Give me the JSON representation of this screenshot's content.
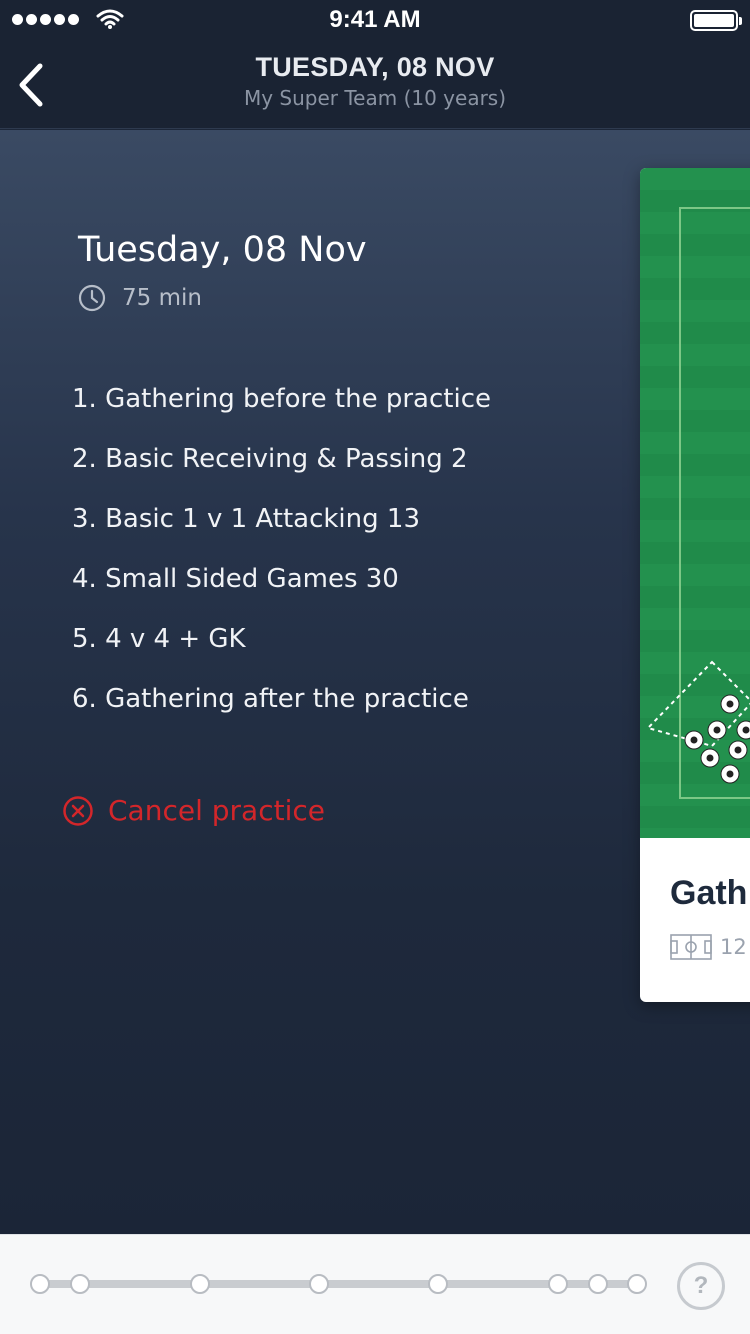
{
  "status": {
    "time": "9:41 AM"
  },
  "nav": {
    "title": "TUESDAY, 08 NOV",
    "subtitle": "My Super Team (10 years)"
  },
  "session": {
    "date": "Tuesday, 08 Nov",
    "duration": "75 min",
    "drills": [
      "1. Gathering before the practice",
      "2. Basic Receiving & Passing 2",
      "3. Basic 1 v 1 Attacking 13",
      "4. Small Sided Games 30",
      "5. 4 v 4 + GK",
      "6. Gathering after the practice"
    ],
    "cancel_label": "Cancel practice"
  },
  "card": {
    "title": "Gath",
    "count": "12"
  },
  "progress": {
    "dot_count": 8
  },
  "help": {
    "label": "?"
  },
  "colors": {
    "accent_red": "#d3262a",
    "pitch_green": "#23914e",
    "navy": "#1a2333"
  }
}
